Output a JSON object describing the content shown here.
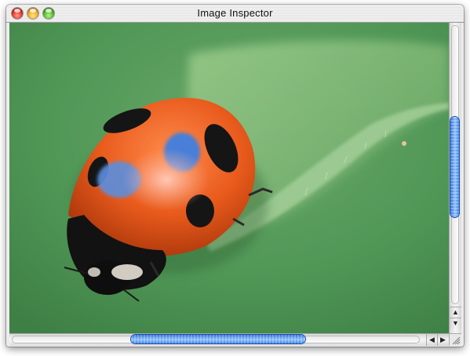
{
  "window": {
    "title": "Image Inspector"
  },
  "scrollbars": {
    "vertical": {
      "up_arrow": "▲",
      "down_arrow": "▼"
    },
    "horizontal": {
      "left_arrow": "◀",
      "right_arrow": "▶"
    }
  },
  "icons": {
    "close": "close-icon",
    "minimize": "minimize-icon",
    "zoom": "zoom-icon",
    "resize": "resize-grip-icon"
  },
  "colors": {
    "background_green": "#4f9655",
    "leaf_green": "#7fb872",
    "ladybug_orange": "#e85a1c",
    "spot_black": "#151515",
    "scroll_thumb_blue": "#3f7fe0"
  }
}
